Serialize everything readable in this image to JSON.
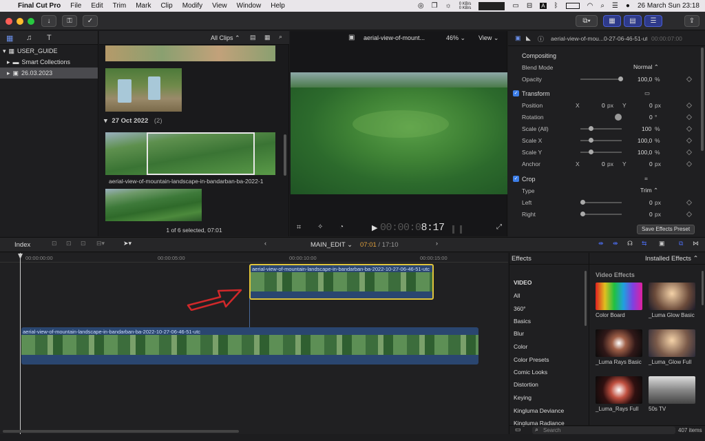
{
  "menubar": {
    "app": "Final Cut Pro",
    "items": [
      "File",
      "Edit",
      "Trim",
      "Mark",
      "Clip",
      "Modify",
      "View",
      "Window",
      "Help"
    ],
    "net_up": "0 KB/s",
    "net_down": "0 KB/s",
    "datetime": "26 March Sun  23:18"
  },
  "library": {
    "root": "USER_GUIDE",
    "items": [
      {
        "label": "Smart Collections"
      },
      {
        "label": "26.03.2023"
      }
    ]
  },
  "browser": {
    "filter": "All Clips",
    "date_group": "27 Oct 2022",
    "group_count": "(2)",
    "clip_name": "aerial-view-of-mountain-landscape-in-bandarban-ba-2022-1",
    "status": "1 of 6 selected, 07:01"
  },
  "viewer": {
    "title": "aerial-view-of-mount...",
    "zoom": "46%",
    "view_label": "View",
    "timecode_dim": "00:00:0",
    "timecode": "8:17"
  },
  "inspector": {
    "title": "aerial-view-of-mou...0-27-06-46-51-utc",
    "time": "00:00:07:00",
    "compositing": "Compositing",
    "blend_mode_label": "Blend Mode",
    "blend_mode": "Normal",
    "opacity_label": "Opacity",
    "opacity": "100,0",
    "pct": "%",
    "transform": "Transform",
    "position_label": "Position",
    "x": "X",
    "y": "Y",
    "pos_x": "0",
    "pos_y": "0",
    "px": "px",
    "rotation_label": "Rotation",
    "rotation": "0",
    "deg": "°",
    "scale_all_label": "Scale (All)",
    "scale_all": "100",
    "scale_x_label": "Scale X",
    "scale_x": "100,0",
    "scale_y_label": "Scale Y",
    "scale_y": "100,0",
    "anchor_label": "Anchor",
    "anchor_x": "0",
    "anchor_y": "0",
    "crop": "Crop",
    "type_label": "Type",
    "type": "Trim",
    "left_label": "Left",
    "left": "0",
    "right_label": "Right",
    "right": "0",
    "save_preset": "Save Effects Preset"
  },
  "timeline_bar": {
    "index": "Index",
    "project": "MAIN_EDIT",
    "time_current": "07:01",
    "time_total": "17:10"
  },
  "timeline": {
    "ruler": [
      "00:00:00:00",
      "00:00:05:00",
      "00:00:10:00",
      "00:00:15:00"
    ],
    "upper_clip": "aerial-view-of-mountain-landscape-in-bandarban-ba-2022-10-27-06-46-51-utc",
    "main_clip": "aerial-view-of-mountain-landscape-in-bandarban-ba-2022-10-27-06-46-51-utc"
  },
  "effects": {
    "header": "Effects",
    "installed": "Installed Effects",
    "section": "VIDEO",
    "categories": [
      "All",
      "360°",
      "Basics",
      "Blur",
      "Color",
      "Color Presets",
      "Comic Looks",
      "Distortion",
      "Keying",
      "Kingluma Deviance",
      "Kingluma Radiance"
    ],
    "group_title": "Video Effects",
    "tiles": [
      "Color Board",
      "_Luma Glow Basic",
      "_Luma Rays Basic",
      "_Luma_Glow Full",
      "_Luma_Rays Full",
      "50s TV"
    ],
    "search_placeholder": "Search",
    "count": "407 items"
  }
}
